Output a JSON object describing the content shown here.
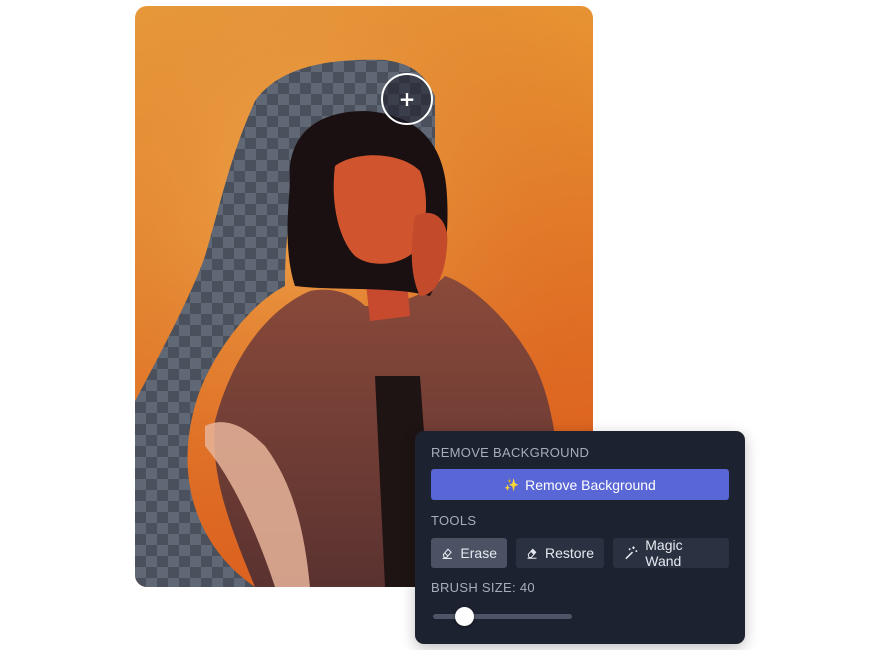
{
  "panel": {
    "remove_title": "REMOVE BACKGROUND",
    "remove_button": "Remove Background",
    "remove_button_icon": "sparkles-icon",
    "tools_title": "TOOLS",
    "tools": [
      {
        "label": "Erase",
        "icon": "eraser-icon",
        "active": true
      },
      {
        "label": "Restore",
        "icon": "restore-eraser-icon",
        "active": false
      },
      {
        "label": "Magic Wand",
        "icon": "magic-wand-icon",
        "active": false
      }
    ],
    "brush_title": "BRUSH SIZE: 40",
    "brush_size": 40
  },
  "cursor": {
    "symbol": "+"
  },
  "colors": {
    "panel_bg": "#1c2230",
    "primary": "#5966d6",
    "active_tool": "#4b5263",
    "photo_orange": "#e58a2e"
  }
}
